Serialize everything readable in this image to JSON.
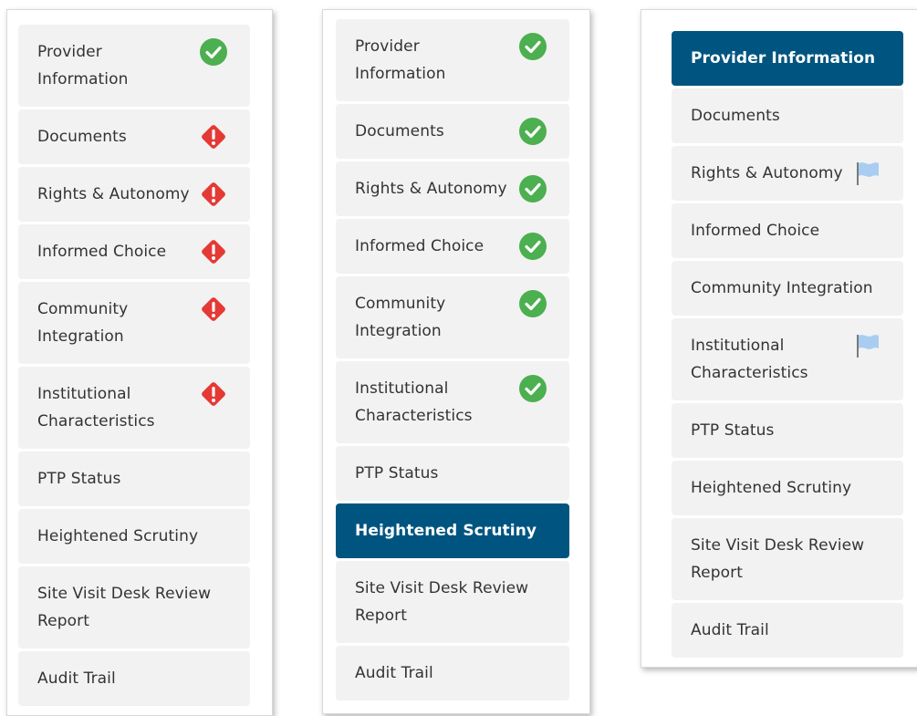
{
  "panels": [
    {
      "items": [
        {
          "label": "Provider Information",
          "status": "complete",
          "active": true
        },
        {
          "label": "Documents",
          "status": "error",
          "active": false
        },
        {
          "label": "Rights & Autonomy",
          "status": "error",
          "active": false
        },
        {
          "label": "Informed Choice",
          "status": "error",
          "active": false
        },
        {
          "label": "Community Integration",
          "status": "error",
          "active": false
        },
        {
          "label": "Institutional Characteristics",
          "status": "error",
          "active": false
        },
        {
          "label": "PTP Status",
          "status": "none",
          "active": false
        },
        {
          "label": "Heightened Scrutiny",
          "status": "none",
          "active": false
        },
        {
          "label": "Site Visit Desk Review Report",
          "status": "none",
          "active": false
        },
        {
          "label": "Audit Trail",
          "status": "none",
          "active": false
        }
      ]
    },
    {
      "items": [
        {
          "label": "Provider Information",
          "status": "complete",
          "active": false
        },
        {
          "label": "Documents",
          "status": "complete",
          "active": false
        },
        {
          "label": "Rights & Autonomy",
          "status": "complete",
          "active": false
        },
        {
          "label": "Informed Choice",
          "status": "complete",
          "active": false
        },
        {
          "label": "Community Integration",
          "status": "complete",
          "active": false
        },
        {
          "label": "Institutional Characteristics",
          "status": "complete",
          "active": false
        },
        {
          "label": "PTP Status",
          "status": "none",
          "active": false
        },
        {
          "label": "Heightened Scrutiny",
          "status": "none",
          "active": true
        },
        {
          "label": "Site Visit Desk Review Report",
          "status": "none",
          "active": false
        },
        {
          "label": "Audit Trail",
          "status": "none",
          "active": false
        }
      ]
    },
    {
      "items": [
        {
          "label": "Provider Information",
          "status": "none",
          "active": true
        },
        {
          "label": "Documents",
          "status": "none",
          "active": false
        },
        {
          "label": "Rights & Autonomy",
          "status": "flagged",
          "active": false
        },
        {
          "label": "Informed Choice",
          "status": "none",
          "active": false
        },
        {
          "label": "Community Integration",
          "status": "none",
          "active": false
        },
        {
          "label": "Institutional Characteristics",
          "status": "flagged",
          "active": false
        },
        {
          "label": "PTP Status",
          "status": "none",
          "active": false
        },
        {
          "label": "Heightened Scrutiny",
          "status": "none",
          "active": false
        },
        {
          "label": "Site Visit Desk Review Report",
          "status": "none",
          "active": false
        },
        {
          "label": "Audit Trail",
          "status": "none",
          "active": false
        }
      ]
    }
  ],
  "icons": {
    "complete": "check-circle-icon",
    "error": "exclamation-diamond-icon",
    "flagged": "flag-icon"
  },
  "colors": {
    "active_bg": "#005580",
    "item_bg": "#f2f2f2",
    "text": "#333333",
    "active_text": "#ffffff",
    "complete": "#4caf50",
    "error": "#e53935",
    "flag": "#a8cdf0"
  }
}
